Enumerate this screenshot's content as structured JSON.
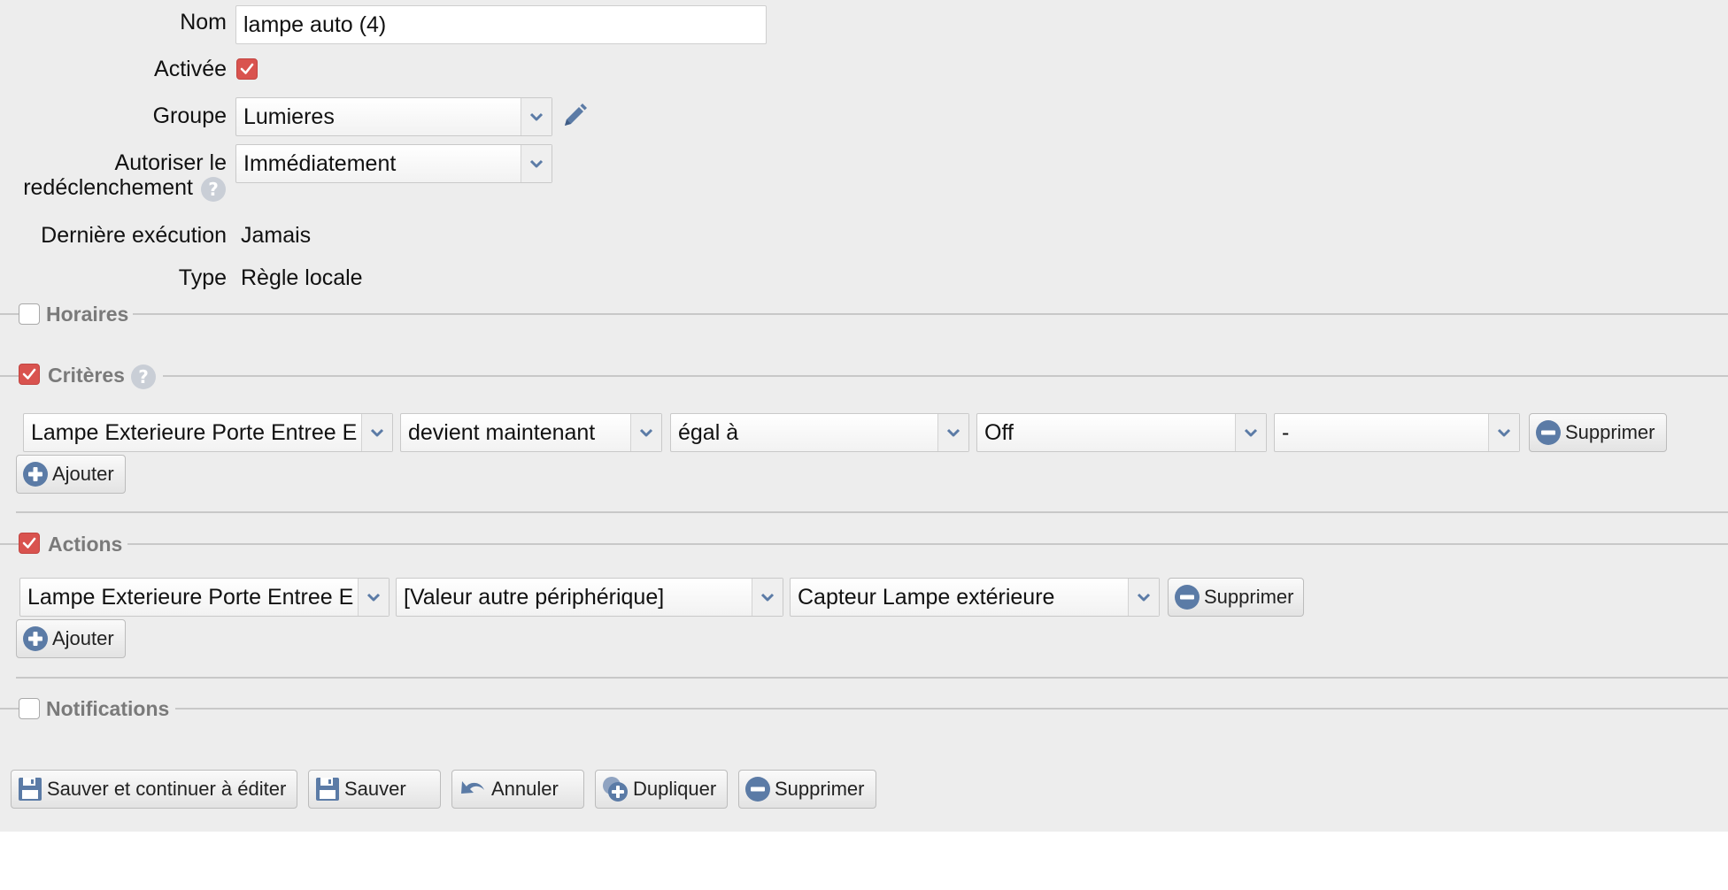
{
  "form": {
    "name": {
      "label": "Nom",
      "value": "lampe auto (4)"
    },
    "enabled": {
      "label": "Activée",
      "checked": true
    },
    "group": {
      "label": "Groupe",
      "value": "Lumieres",
      "edit_icon": "pencil-icon"
    },
    "retrigger": {
      "label_line1": "Autoriser le",
      "label_line2": "redéclenchement",
      "value": "Immédiatement",
      "help_icon": "help-icon"
    },
    "last_execution": {
      "label": "Dernière exécution",
      "value": "Jamais"
    },
    "type": {
      "label": "Type",
      "value": "Règle locale"
    }
  },
  "sections": {
    "schedules": {
      "title": "Horaires",
      "checked": false
    },
    "criteria": {
      "title": "Critères",
      "checked": true,
      "help_icon": "help-icon",
      "row": {
        "device": "Lampe Exterieure Porte Entree Exte",
        "event": "devient maintenant",
        "operator": "égal à",
        "value": "Off",
        "extra": "-",
        "remove_label": "Supprimer"
      },
      "add_label": "Ajouter"
    },
    "actions": {
      "title": "Actions",
      "checked": true,
      "row": {
        "device": "Lampe Exterieure Porte Entree Exte",
        "mode": "[Valeur autre périphérique]",
        "source": "Capteur Lampe extérieure",
        "remove_label": "Supprimer"
      },
      "add_label": "Ajouter"
    },
    "notifications": {
      "title": "Notifications",
      "checked": false
    }
  },
  "footer": {
    "save_continue": "Sauver et continuer à éditer",
    "save": "Sauver",
    "cancel": "Annuler",
    "duplicate": "Dupliquer",
    "delete": "Supprimer"
  },
  "colors": {
    "checkbox_checked": "#d9534f",
    "icon_blue": "#5b7ba6",
    "panel_bg": "#ededed"
  }
}
